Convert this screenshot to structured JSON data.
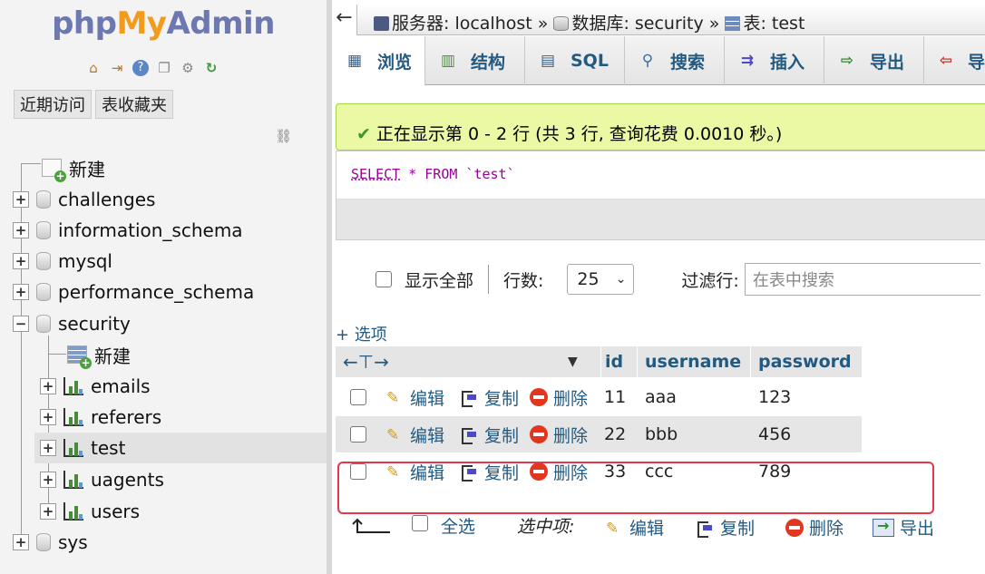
{
  "logo": {
    "part1": "php",
    "part2": "My",
    "part3": "Admin"
  },
  "quick_icons": [
    "home-icon",
    "logout-icon",
    "help-icon",
    "docs-icon",
    "settings-icon",
    "reload-icon"
  ],
  "nav_tabs": {
    "recent": "近期访问",
    "favorites": "表收藏夹"
  },
  "tree": {
    "new_root": "新建",
    "dbs": [
      "challenges",
      "information_schema",
      "mysql",
      "performance_schema",
      "security"
    ],
    "security_new": "新建",
    "tables": [
      "emails",
      "referers",
      "test",
      "uagents",
      "users"
    ],
    "last_db": "sys"
  },
  "breadcrumb": {
    "server": "服务器: localhost »",
    "database": "数据库: security »",
    "table": "表: test"
  },
  "tabs": [
    "浏览",
    "结构",
    "SQL",
    "搜索",
    "插入",
    "导出",
    "导"
  ],
  "notice": "正在显示第 0 - 2 行 (共 3 行, 查询花费 0.0010 秒。)",
  "sql": {
    "select": "SELECT",
    "rest": " * FROM `test`"
  },
  "controls": {
    "show_all": "显示全部",
    "rows_label": "行数:",
    "rows_value": "25",
    "filter_label": "过滤行:",
    "filter_placeholder": "在表中搜索"
  },
  "options_link": "+ 选项",
  "columns": [
    "id",
    "username",
    "password"
  ],
  "actions": {
    "edit": "编辑",
    "copy": "复制",
    "delete": "删除"
  },
  "rows": [
    {
      "id": "11",
      "username": "aaa",
      "password": "123"
    },
    {
      "id": "22",
      "username": "bbb",
      "password": "456"
    },
    {
      "id": "33",
      "username": "ccc",
      "password": "789"
    }
  ],
  "bulk": {
    "select_all": "全选",
    "with_selected": "选中项:",
    "edit": "编辑",
    "copy": "复制",
    "delete": "删除",
    "export": "导出"
  },
  "colors": {
    "link": "#235a81",
    "notice_bg": "#ebf8a4",
    "highlight": "#e2394a"
  }
}
